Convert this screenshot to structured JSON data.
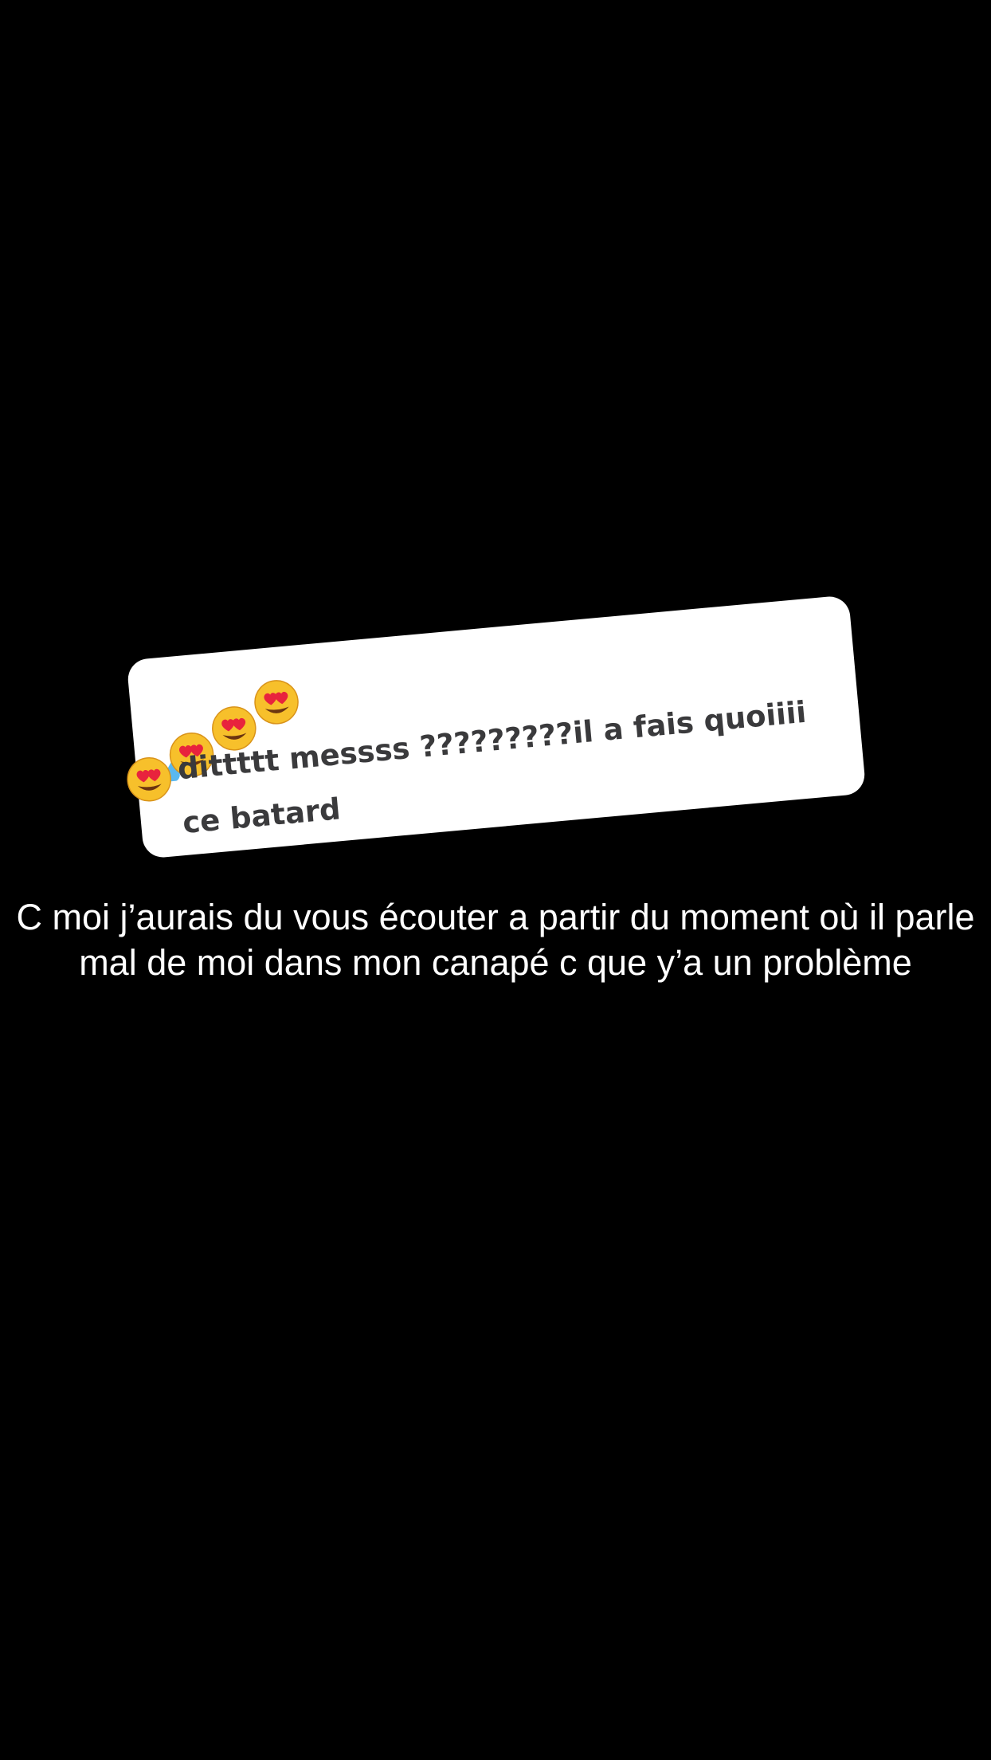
{
  "story": {
    "background_color": "#000000",
    "comment": {
      "reaction_emojis": [
        "smiling-face-with-heart-eyes",
        "smiling-face-with-heart-eyes",
        "smiling-face-with-heart-eyes",
        "smiling-face-with-heart-eyes"
      ],
      "text": "dittttt messss ?????????il a fais quoiiii ce batard"
    },
    "caption": "C moi j’aurais du vous écouter a partir du moment où il parle mal de moi dans mon canapé c que y’a un problème"
  }
}
